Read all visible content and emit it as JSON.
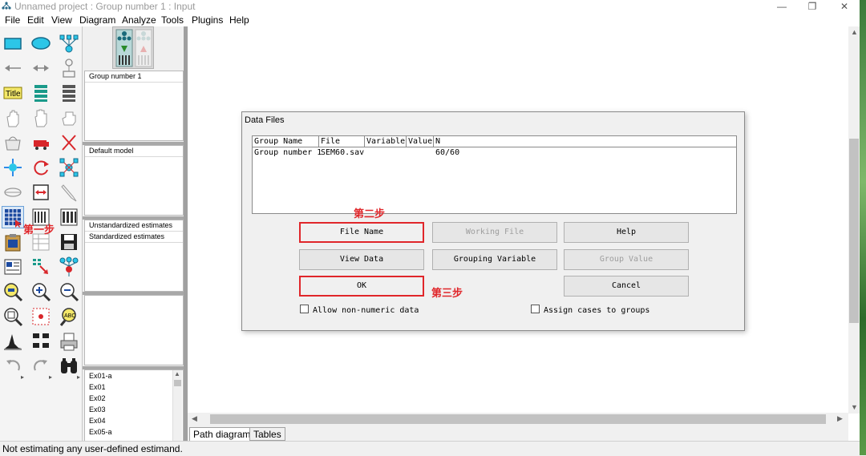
{
  "window": {
    "title": "Unnamed project : Group number 1 : Input",
    "controls": [
      "—",
      "❐",
      "✕"
    ]
  },
  "menu": [
    "File",
    "Edit",
    "View",
    "Diagram",
    "Analyze",
    "Tools",
    "Plugins",
    "Help"
  ],
  "panels": {
    "groups": [
      "Group number 1"
    ],
    "models": [
      "Default model"
    ],
    "estimates": [
      "Unstandardized estimates",
      "Standardized estimates"
    ],
    "files": [
      "Ex01-a",
      "Ex01",
      "Ex02",
      "Ex03",
      "Ex04",
      "Ex05-a"
    ]
  },
  "dialog": {
    "title": "Data Files",
    "columns": [
      "Group Name",
      "File",
      "Variable",
      "Value",
      "N"
    ],
    "row": {
      "group": "Group number 1",
      "file": "SEM60.sav",
      "variable": "",
      "value": "",
      "n": "60/60"
    },
    "buttons": {
      "file_name": "File Name",
      "working_file": "Working File",
      "help": "Help",
      "view_data": "View Data",
      "grouping_variable": "Grouping Variable",
      "group_value": "Group Value",
      "ok": "OK",
      "cancel": "Cancel"
    },
    "checkboxes": {
      "allow_non_numeric": "Allow non-numeric data",
      "assign_cases": "Assign cases to groups"
    }
  },
  "annotations": {
    "step1": "第一步",
    "step2": "第二步",
    "step3": "第三步"
  },
  "tabs": [
    "Path diagram",
    "Tables"
  ],
  "status": "Not estimating any user-defined estimand.",
  "colors": {
    "annotation_red": "#e0262a",
    "dialog_bg": "#f0f0f0",
    "toolbox_bg": "#f4f4f4"
  }
}
